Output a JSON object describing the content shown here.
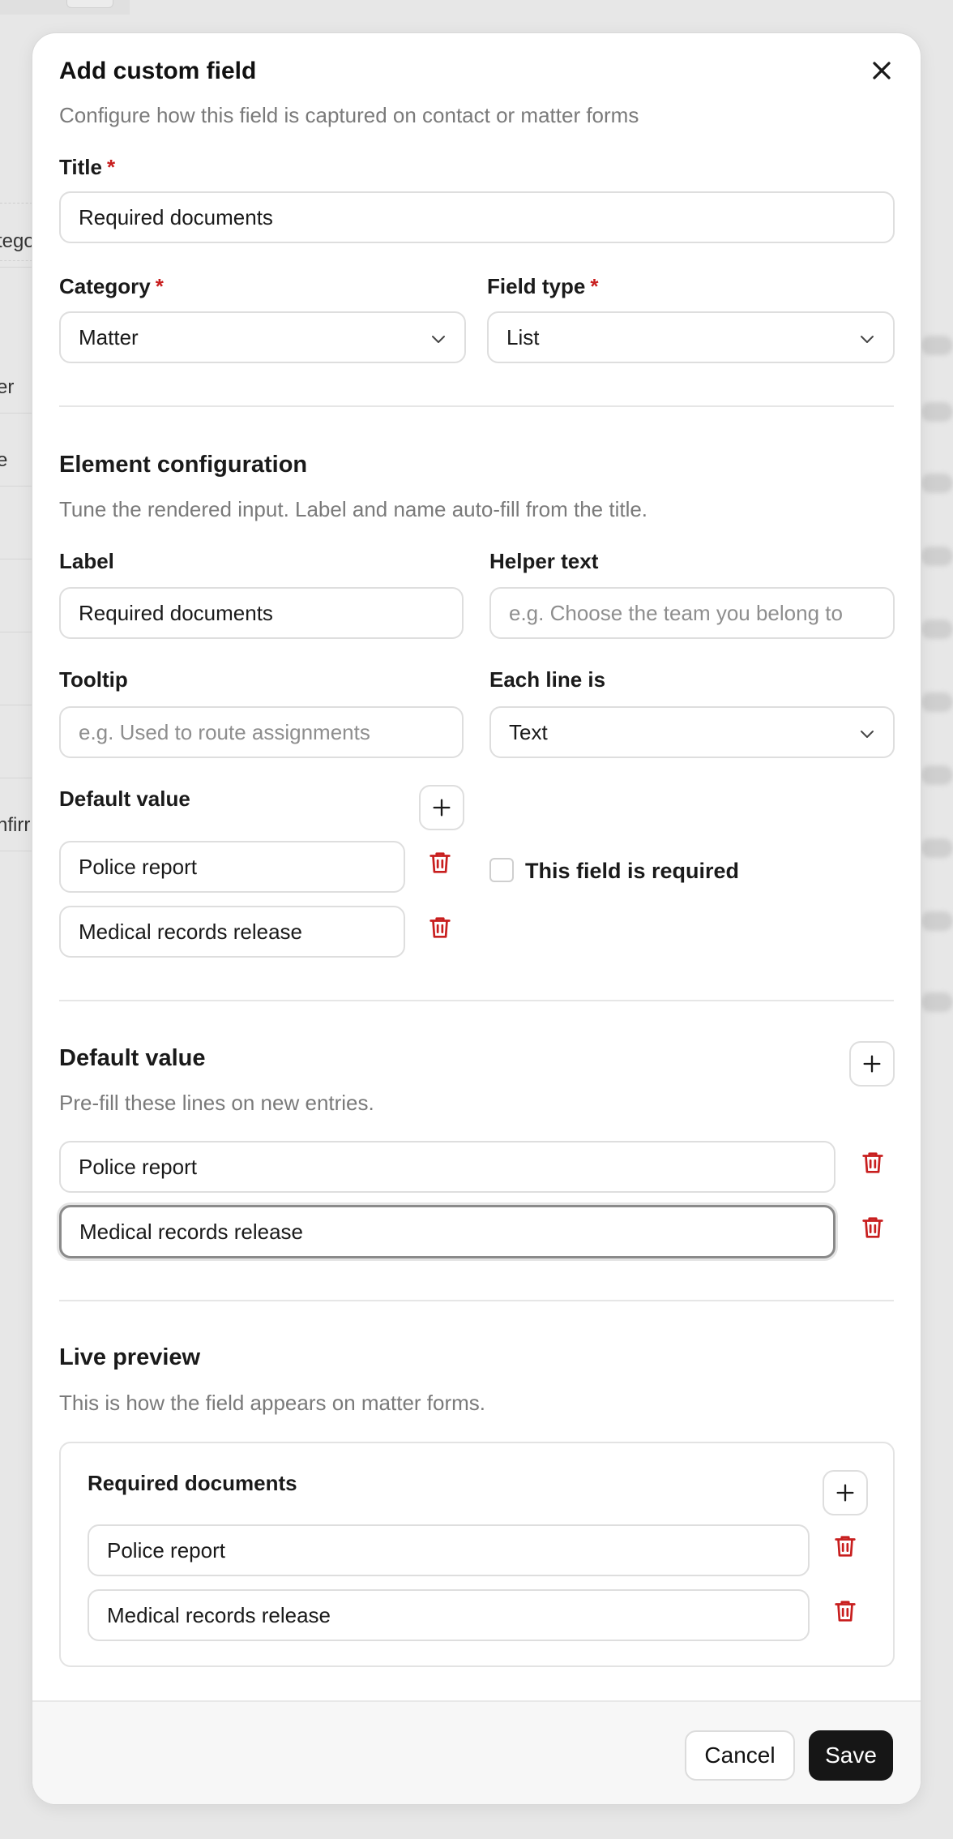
{
  "background": {
    "left_fragments": [
      "tego",
      "er",
      "e",
      "nfirr"
    ]
  },
  "modal": {
    "title": "Add custom field",
    "subtitle": "Configure how this field is captured on contact or matter forms",
    "title_label": "Title",
    "title_value": "Required documents",
    "category_label": "Category",
    "category_value": "Matter",
    "field_type_label": "Field type",
    "field_type_value": "List",
    "required_marker": "*"
  },
  "element_config": {
    "heading": "Element configuration",
    "description": "Tune the rendered input. Label and name auto-fill from the title.",
    "label_label": "Label",
    "label_value": "Required documents",
    "helper_label": "Helper text",
    "helper_placeholder": "e.g. Choose the team you belong to",
    "tooltip_label": "Tooltip",
    "tooltip_placeholder": "e.g. Used to route assignments",
    "each_line_label": "Each line is",
    "each_line_value": "Text",
    "default_label": "Default value",
    "default_items": [
      "Police report",
      "Medical records release"
    ],
    "required_checkbox_label": "This field is required",
    "required_checked": false
  },
  "default_section": {
    "heading": "Default value",
    "description": "Pre-fill these lines on new entries.",
    "items": [
      "Police report",
      "Medical records release"
    ]
  },
  "preview": {
    "heading": "Live preview",
    "description": "This is how the field appears on matter forms.",
    "field_title": "Required documents",
    "items": [
      "Police report",
      "Medical records release"
    ]
  },
  "footer": {
    "cancel_label": "Cancel",
    "save_label": "Save"
  },
  "colors": {
    "accent_required": "#c81e1e",
    "trash_icon": "#c81e1e",
    "save_button": "#161616"
  }
}
